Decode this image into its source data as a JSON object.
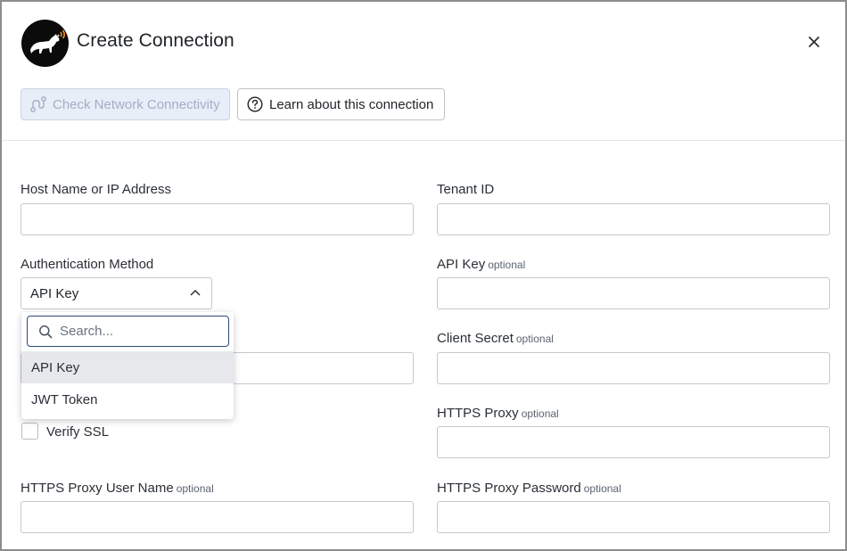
{
  "dialog": {
    "title": "Create Connection",
    "close_icon": "close-icon",
    "logo_icon": "dog-logo-icon"
  },
  "toolbar": {
    "check_network_label": "Check Network Connectivity",
    "check_network_icon": "route-icon",
    "learn_label": "Learn about this connection",
    "learn_icon": "help-circle-icon"
  },
  "form": {
    "host": {
      "label": "Host Name or IP Address",
      "value": ""
    },
    "tenant": {
      "label": "Tenant ID",
      "value": ""
    },
    "auth_method": {
      "label": "Authentication Method",
      "selected": "API Key",
      "search_placeholder": "Search...",
      "options": [
        "API Key",
        "JWT Token"
      ]
    },
    "api_key": {
      "label": "API Key",
      "optional": "optional",
      "value": ""
    },
    "client_secret": {
      "label": "Client Secret",
      "optional": "optional",
      "value": ""
    },
    "https_proxy": {
      "label": "HTTPS Proxy",
      "optional": "optional",
      "value": ""
    },
    "verify_ssl": {
      "label": "Verify SSL",
      "checked": false
    },
    "proxy_user": {
      "label": "HTTPS Proxy User Name",
      "optional": "optional",
      "value": ""
    },
    "proxy_password": {
      "label": "HTTPS Proxy Password",
      "optional": "optional",
      "value": ""
    }
  },
  "colors": {
    "primary_disabled_bg": "#e8eef8",
    "primary_disabled_text": "#a3aec4",
    "focus_border": "#2e4a7a",
    "selected_option_bg": "#e6e8ec",
    "logo_accent": "#f08a24"
  }
}
